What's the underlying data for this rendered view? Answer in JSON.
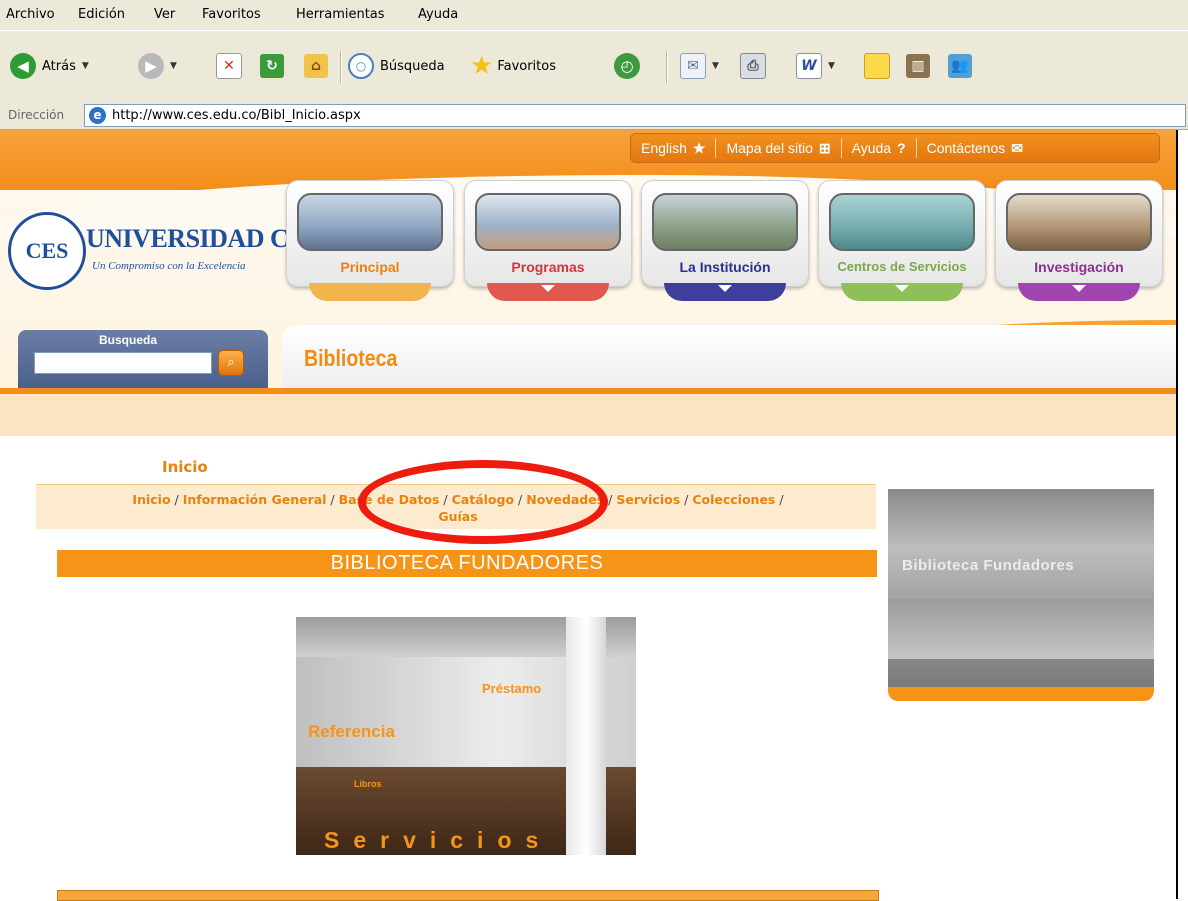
{
  "menu": [
    "Archivo",
    "Edición",
    "Ver",
    "Favoritos",
    "Herramientas",
    "Ayuda"
  ],
  "toolbar": {
    "back_label": "Atrás",
    "search_label": "Búsqueda",
    "favorites_label": "Favoritos"
  },
  "address": {
    "label": "Dirección",
    "url": "http://www.ces.edu.co/Bibl_Inicio.aspx"
  },
  "top_links": [
    {
      "label": "English",
      "icon": "★"
    },
    {
      "label": "Mapa del sitio",
      "icon": "⊞"
    },
    {
      "label": "Ayuda",
      "icon": "?"
    },
    {
      "label": "Contáctenos",
      "icon": "✉"
    }
  ],
  "logo": {
    "mark": "CES",
    "name": "UNIVERSIDAD CES",
    "tagline": "Un Compromiso con la Excelencia"
  },
  "nav_cards": [
    {
      "label": "Principal",
      "color": "#e8820c",
      "arc": "#f2b44d",
      "photo": "#8ea6c2"
    },
    {
      "label": "Programas",
      "color": "#d6333b",
      "arc": "#e0574f",
      "photo": "#9db3c9"
    },
    {
      "label": "La Institución",
      "color": "#2b2f8f",
      "arc": "#3e3f9c",
      "photo": "#8fa38c"
    },
    {
      "label": "Centros de Servicios",
      "color": "#79a84a",
      "arc": "#8dbf5a",
      "photo": "#7fb3b5"
    },
    {
      "label": "Investigación",
      "color": "#8a2f8f",
      "arc": "#a045b0",
      "photo": "#b69b7c"
    }
  ],
  "search": {
    "label": "Busqueda"
  },
  "section": {
    "title": "Biblioteca"
  },
  "breadcrumb_title": "Inicio",
  "nav_links": [
    "Inicio",
    "Información General",
    "Base de Datos",
    "Catálogo",
    "Novedades",
    "Servicios",
    "Colecciones",
    "Guías"
  ],
  "banner": {
    "title": "BIBLIOTECA FUNDADORES"
  },
  "main_photo": {
    "labels": {
      "prestamo": "Préstamo",
      "referencia": "Referencia",
      "libros": "Libros",
      "servicios": "Servicios"
    }
  },
  "side_photo": {
    "sign": "Biblioteca Fundadores"
  },
  "colors": {
    "accent": "#f38d19",
    "highlight_oval": "#ee1c0e",
    "link": "#e8820c"
  }
}
